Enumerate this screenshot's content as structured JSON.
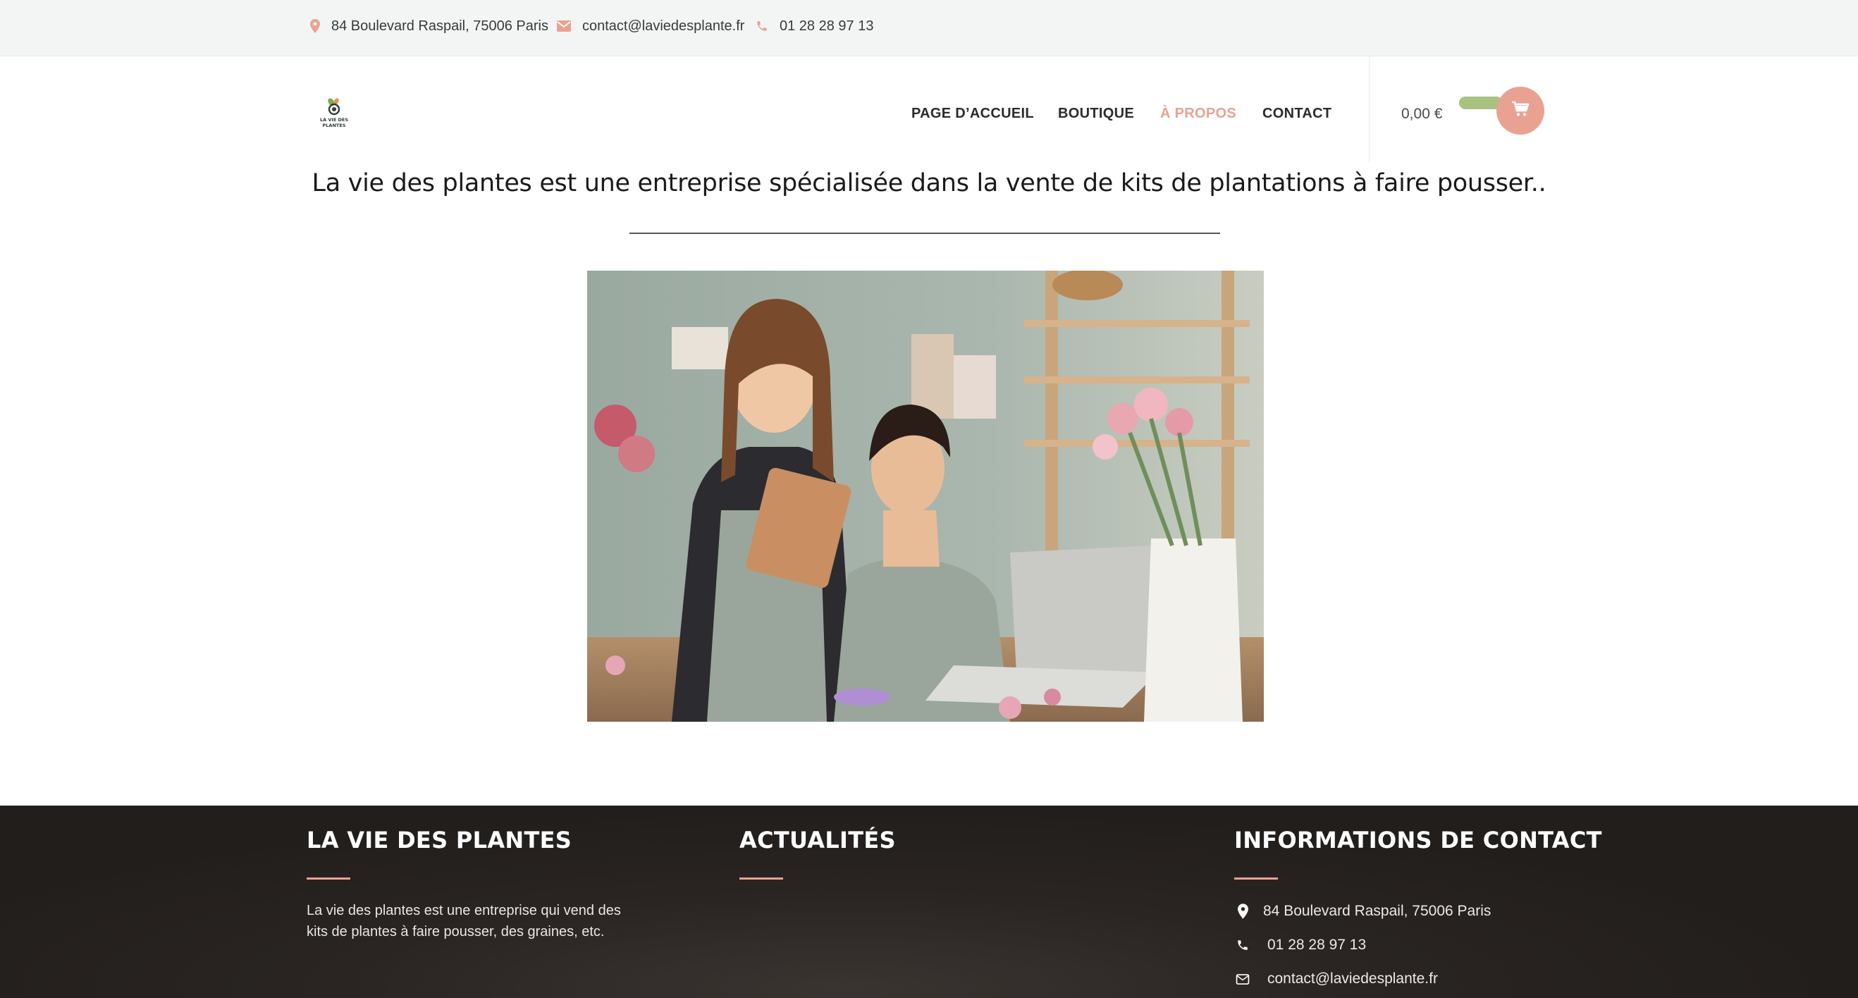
{
  "topbar": {
    "address": "84 Boulevard Raspail, 75006 Paris",
    "email": "contact@laviedesplante.fr",
    "phone": "01 28 28 97 13",
    "icon_color": "#e9a291"
  },
  "header": {
    "logo_text_line1": "LA VIE DES",
    "logo_text_line2": "PLANTES",
    "nav": [
      {
        "label": "PAGE D’ACCUEIL",
        "active": false
      },
      {
        "label": "BOUTIQUE",
        "active": false
      },
      {
        "label": "À PROPOS",
        "active": true
      },
      {
        "label": "CONTACT",
        "active": false
      }
    ],
    "cart_total": "0,00 €",
    "accent_color": "#e9a291",
    "toggle_color": "#a7c37f"
  },
  "main": {
    "tagline": "La vie des plantes est une entreprise spécialisée dans la vente de kits de plantations à faire pousser.."
  },
  "footer": {
    "col1": {
      "title": "LA VIE DES PLANTES",
      "text": "La vie des plantes est une entreprise qui vend des kits de plantes à faire pousser, des graines, etc."
    },
    "col2": {
      "title": "ACTUALITÉS"
    },
    "col3": {
      "title": "INFORMATIONS DE CONTACT",
      "address": "84 Boulevard Raspail, 75006 Paris",
      "phone": "01 28 28 97 13",
      "email": "contact@laviedesplante.fr"
    }
  }
}
